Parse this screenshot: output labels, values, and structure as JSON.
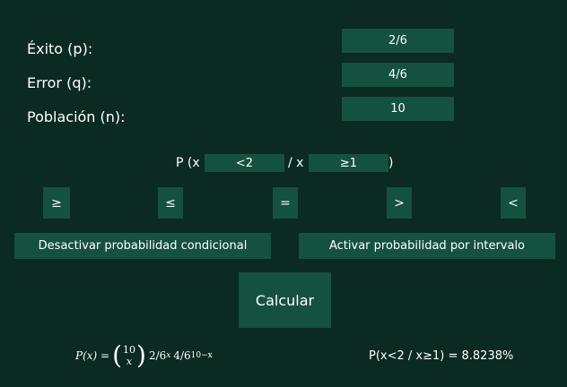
{
  "params": {
    "success": {
      "label": "Éxito (p):",
      "value": "2/6"
    },
    "error": {
      "label": "Error (q):",
      "value": "4/6"
    },
    "population": {
      "label": "Población (n):",
      "value": "10"
    }
  },
  "condition": {
    "prefix": "P (x",
    "event_value": "<2",
    "separator": "/ x",
    "given_value": "≥1",
    "suffix": ")"
  },
  "operators": [
    "≥",
    "≤",
    "=",
    ">",
    "<"
  ],
  "buttons": {
    "disable_conditional": "Desactivar probabilidad condicional",
    "enable_interval": "Activar probabilidad por intervalo",
    "calculate": "Calcular"
  },
  "formula": {
    "lhs": "P(x) =",
    "binom_top": "10",
    "binom_bottom": "x",
    "p_base": "2/6",
    "p_exp": "x",
    "q_base": "4/6",
    "q_exp": "10−x"
  },
  "result": "P(x<2 / x≥1) = 8.8238%"
}
